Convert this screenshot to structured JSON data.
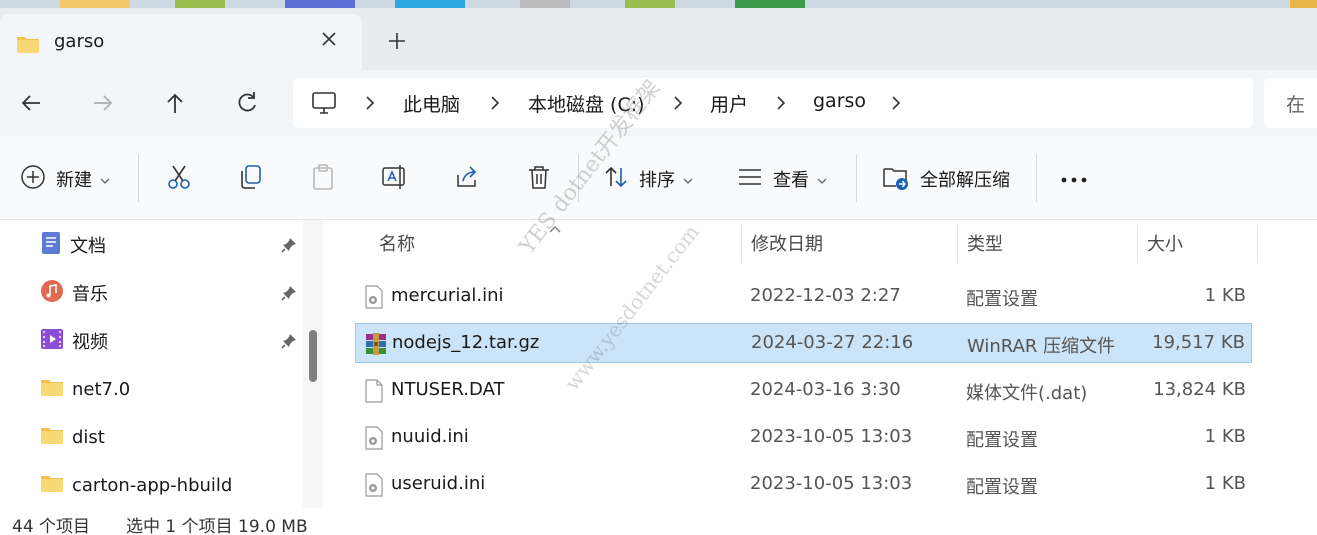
{
  "colors": {
    "tabbar_bg": "#e7ecf2",
    "selection_bg": "#cce4f7",
    "selection_border": "#99c9ef",
    "accent": "#0067c0"
  },
  "tab": {
    "title": "garso",
    "close_icon": "close-icon",
    "new_tab_icon": "plus-icon"
  },
  "nav": {
    "back_icon": "arrow-left-icon",
    "forward_icon": "arrow-right-icon",
    "up_icon": "arrow-up-icon",
    "refresh_icon": "refresh-icon"
  },
  "address": {
    "root_icon": "computer-icon",
    "crumbs": [
      "此电脑",
      "本地磁盘 (C:)",
      "用户",
      "garso"
    ]
  },
  "search": {
    "placeholder": "在"
  },
  "toolbar": {
    "new_label": "新建",
    "sort_label": "排序",
    "view_label": "查看",
    "extract_label": "全部解压缩",
    "more_icon": "more-icon"
  },
  "sidebar": {
    "items": [
      {
        "label": "文档",
        "icon": "documents-icon",
        "pinned": true
      },
      {
        "label": "音乐",
        "icon": "music-icon",
        "pinned": true
      },
      {
        "label": "视频",
        "icon": "video-icon",
        "pinned": true
      },
      {
        "label": "net7.0",
        "icon": "folder-icon",
        "pinned": false
      },
      {
        "label": "dist",
        "icon": "folder-icon",
        "pinned": false
      },
      {
        "label": "carton-app-hbuild",
        "icon": "folder-icon",
        "pinned": false
      }
    ]
  },
  "columns": {
    "name": "名称",
    "modified": "修改日期",
    "type": "类型",
    "size": "大小"
  },
  "files": [
    {
      "name": "mercurial.ini",
      "modified": "2022-12-03 2:27",
      "type": "配置设置",
      "size": "1 KB",
      "icon": "ini-file-icon"
    },
    {
      "name": "nodejs_12.tar.gz",
      "modified": "2024-03-27 22:16",
      "type": "WinRAR 压缩文件",
      "size": "19,517 KB",
      "icon": "winrar-archive-icon",
      "selected": true
    },
    {
      "name": "NTUSER.DAT",
      "modified": "2024-03-16 3:30",
      "type": "媒体文件(.dat)",
      "size": "13,824 KB",
      "icon": "blank-file-icon"
    },
    {
      "name": "nuuid.ini",
      "modified": "2023-10-05 13:03",
      "type": "配置设置",
      "size": "1 KB",
      "icon": "ini-file-icon"
    },
    {
      "name": "useruid.ini",
      "modified": "2023-10-05 13:03",
      "type": "配置设置",
      "size": "1 KB",
      "icon": "ini-file-icon"
    }
  ],
  "status": {
    "count": "44 个项目",
    "selection": "选中 1 个项目 19.0 MB"
  },
  "watermark": {
    "line1": "YES dotnet开发框架",
    "line2": "www.yesdotnet.com"
  }
}
